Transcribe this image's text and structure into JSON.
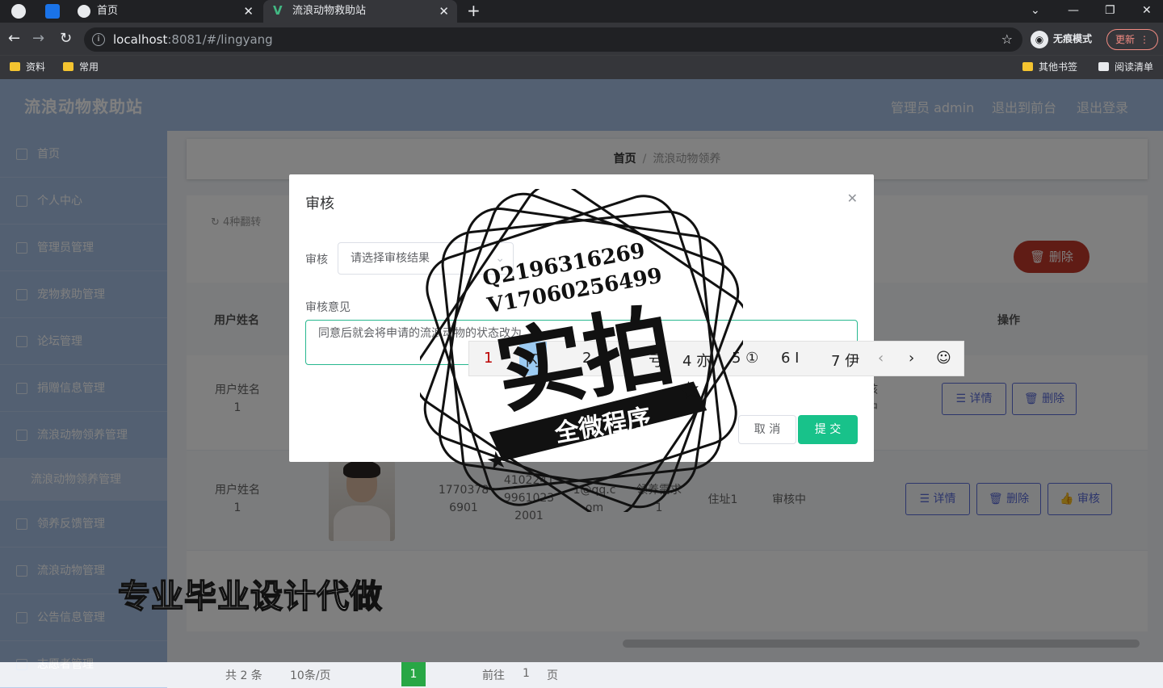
{
  "browser": {
    "tabs": [
      {
        "label": "首页",
        "close": "✕"
      },
      {
        "label": "流浪动物救助站",
        "close": "✕"
      }
    ],
    "vue_logo": "V",
    "new_tab": "+",
    "window_controls": [
      "⌄",
      "—",
      "❐",
      "✕"
    ],
    "nav": {
      "back": "←",
      "forward": "→",
      "reload": "↻"
    },
    "url_host": "localhost",
    "url_rest": ":8081/#/lingyang",
    "info_icon": "i",
    "star_icon": "☆",
    "incognito_label": "无痕模式",
    "incognito_icon": "◉",
    "update_label": "更新",
    "update_menu": "⋮",
    "bookmarks": [
      "资料",
      "常用"
    ],
    "bookmarks_right": [
      "其他书签",
      "阅读清单"
    ]
  },
  "app": {
    "brand": "流浪动物救助站",
    "top_links": [
      "管理员 admin",
      "退出到前台",
      "退出登录"
    ],
    "sidebar": [
      "首页",
      "个人中心",
      "管理员管理",
      "宠物救助管理",
      "论坛管理",
      "捐赠信息管理",
      "流浪动物领养管理",
      "流浪动物领养管理",
      "领养反馈管理",
      "流浪动物管理",
      "公告信息管理",
      "志愿者管理"
    ],
    "breadcrumb": {
      "home": "首页",
      "sep": "/",
      "current": "流浪动物领养"
    },
    "reset_label": "↻ 4种翻转",
    "delete_big": "🗑 删除",
    "table_headers": [
      "用户姓名",
      "操作"
    ],
    "row1": {
      "name": "用户姓名\n1",
      "partial": "核\n中",
      "btn_detail": "☰ 详情",
      "btn_delete": "🗑 删除"
    },
    "row2": {
      "name": "用户姓名\n1",
      "phone": "1770378\n6901",
      "idcard": "4102241\n9961023\n2001",
      "email": "1@qq.c\nom",
      "need": "领养需求\n1",
      "address": "住址1",
      "status": "审核中",
      "btn_detail": "☰ 详情",
      "btn_delete": "🗑 删除",
      "btn_audit": "👍 审核"
    },
    "pager": {
      "total": "共 2 条",
      "size": "10条/页",
      "current": "1",
      "goto_prefix": "前往",
      "goto_value": "1",
      "goto_suffix": "页"
    }
  },
  "dialog": {
    "title": "审核",
    "close": "✕",
    "audit_label": "审核",
    "select_placeholder": "请选择审核结果",
    "select_arrow": "⌄",
    "opinion_label": "审核意见",
    "opinion_value": "同意后就会将申请的流浪动物的状态改为",
    "cancel": "取 消",
    "submit": "提 交"
  },
  "ime": {
    "candidates": [
      "1",
      "闪",
      "2",
      "亏",
      "4 亦",
      "5 ①",
      "6 I",
      "7 伊"
    ],
    "prev": "‹",
    "next": "›",
    "emoji": "☺"
  },
  "watermark": {
    "qq": "Q2196316269",
    "wx": "V17060256499",
    "big": "实拍",
    "ribbon": "全微程序",
    "bottom_text": "专业毕业设计代做"
  }
}
